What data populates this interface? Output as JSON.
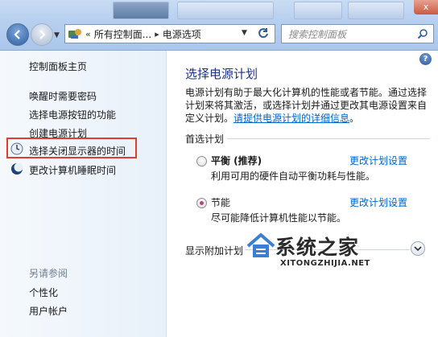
{
  "nav": {
    "breadcrumb": {
      "overflow_marker": "«",
      "items": [
        "所有控制面...",
        "电源选项"
      ],
      "separator": "▸"
    },
    "search_placeholder": "搜索控制面板",
    "close_label": "x"
  },
  "sidebar": {
    "items": [
      {
        "label": "控制面板主页",
        "icon": null
      },
      {
        "label": "唤醒时需要密码",
        "icon": null
      },
      {
        "label": "选择电源按钮的功能",
        "icon": null
      },
      {
        "label": "创建电源计划",
        "icon": null
      },
      {
        "label": "选择关闭显示器的时间",
        "icon": "clock-icon",
        "highlighted": true
      },
      {
        "label": "更改计算机睡眠时间",
        "icon": "moon-icon"
      }
    ],
    "see_also": {
      "header": "另请参阅",
      "items": [
        "个性化",
        "用户帐户"
      ]
    }
  },
  "main": {
    "help_label": "?",
    "title": "选择电源计划",
    "intro_text": "电源计划有助于最大化计算机的性能或者节能。通过选择计划来将其激活，或选择计划并通过更改其电源设置来自定义计划。",
    "intro_link": "请提供电源计划的详细信息",
    "intro_end": "。",
    "preferred_header": "首选计划",
    "plans": [
      {
        "name": "平衡 (推荐)",
        "description": "利用可用的硬件自动平衡功耗与性能。",
        "link": "更改计划设置",
        "selected": false
      },
      {
        "name": "节能",
        "description": "尽可能降低计算机性能以节能。",
        "link": "更改计划设置",
        "selected": true
      }
    ],
    "more_plans_label": "显示附加计划"
  },
  "watermark": {
    "title": "系统之家",
    "subtitle": "XITONGZHIJIA.NET"
  },
  "colors": {
    "title_blue": "#1e3287",
    "link_blue": "#0066cc",
    "highlight_red": "#e03c31",
    "selected_radio": "#b4487a"
  }
}
